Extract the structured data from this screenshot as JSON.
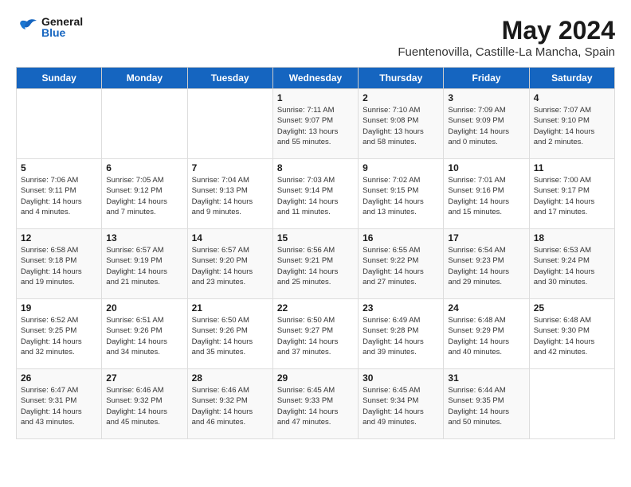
{
  "logo": {
    "general": "General",
    "blue": "Blue"
  },
  "title": "May 2024",
  "subtitle": "Fuentenovilla, Castille-La Mancha, Spain",
  "days_of_week": [
    "Sunday",
    "Monday",
    "Tuesday",
    "Wednesday",
    "Thursday",
    "Friday",
    "Saturday"
  ],
  "weeks": [
    [
      {
        "day": "",
        "info": ""
      },
      {
        "day": "",
        "info": ""
      },
      {
        "day": "",
        "info": ""
      },
      {
        "day": "1",
        "info": "Sunrise: 7:11 AM\nSunset: 9:07 PM\nDaylight: 13 hours\nand 55 minutes."
      },
      {
        "day": "2",
        "info": "Sunrise: 7:10 AM\nSunset: 9:08 PM\nDaylight: 13 hours\nand 58 minutes."
      },
      {
        "day": "3",
        "info": "Sunrise: 7:09 AM\nSunset: 9:09 PM\nDaylight: 14 hours\nand 0 minutes."
      },
      {
        "day": "4",
        "info": "Sunrise: 7:07 AM\nSunset: 9:10 PM\nDaylight: 14 hours\nand 2 minutes."
      }
    ],
    [
      {
        "day": "5",
        "info": "Sunrise: 7:06 AM\nSunset: 9:11 PM\nDaylight: 14 hours\nand 4 minutes."
      },
      {
        "day": "6",
        "info": "Sunrise: 7:05 AM\nSunset: 9:12 PM\nDaylight: 14 hours\nand 7 minutes."
      },
      {
        "day": "7",
        "info": "Sunrise: 7:04 AM\nSunset: 9:13 PM\nDaylight: 14 hours\nand 9 minutes."
      },
      {
        "day": "8",
        "info": "Sunrise: 7:03 AM\nSunset: 9:14 PM\nDaylight: 14 hours\nand 11 minutes."
      },
      {
        "day": "9",
        "info": "Sunrise: 7:02 AM\nSunset: 9:15 PM\nDaylight: 14 hours\nand 13 minutes."
      },
      {
        "day": "10",
        "info": "Sunrise: 7:01 AM\nSunset: 9:16 PM\nDaylight: 14 hours\nand 15 minutes."
      },
      {
        "day": "11",
        "info": "Sunrise: 7:00 AM\nSunset: 9:17 PM\nDaylight: 14 hours\nand 17 minutes."
      }
    ],
    [
      {
        "day": "12",
        "info": "Sunrise: 6:58 AM\nSunset: 9:18 PM\nDaylight: 14 hours\nand 19 minutes."
      },
      {
        "day": "13",
        "info": "Sunrise: 6:57 AM\nSunset: 9:19 PM\nDaylight: 14 hours\nand 21 minutes."
      },
      {
        "day": "14",
        "info": "Sunrise: 6:57 AM\nSunset: 9:20 PM\nDaylight: 14 hours\nand 23 minutes."
      },
      {
        "day": "15",
        "info": "Sunrise: 6:56 AM\nSunset: 9:21 PM\nDaylight: 14 hours\nand 25 minutes."
      },
      {
        "day": "16",
        "info": "Sunrise: 6:55 AM\nSunset: 9:22 PM\nDaylight: 14 hours\nand 27 minutes."
      },
      {
        "day": "17",
        "info": "Sunrise: 6:54 AM\nSunset: 9:23 PM\nDaylight: 14 hours\nand 29 minutes."
      },
      {
        "day": "18",
        "info": "Sunrise: 6:53 AM\nSunset: 9:24 PM\nDaylight: 14 hours\nand 30 minutes."
      }
    ],
    [
      {
        "day": "19",
        "info": "Sunrise: 6:52 AM\nSunset: 9:25 PM\nDaylight: 14 hours\nand 32 minutes."
      },
      {
        "day": "20",
        "info": "Sunrise: 6:51 AM\nSunset: 9:26 PM\nDaylight: 14 hours\nand 34 minutes."
      },
      {
        "day": "21",
        "info": "Sunrise: 6:50 AM\nSunset: 9:26 PM\nDaylight: 14 hours\nand 35 minutes."
      },
      {
        "day": "22",
        "info": "Sunrise: 6:50 AM\nSunset: 9:27 PM\nDaylight: 14 hours\nand 37 minutes."
      },
      {
        "day": "23",
        "info": "Sunrise: 6:49 AM\nSunset: 9:28 PM\nDaylight: 14 hours\nand 39 minutes."
      },
      {
        "day": "24",
        "info": "Sunrise: 6:48 AM\nSunset: 9:29 PM\nDaylight: 14 hours\nand 40 minutes."
      },
      {
        "day": "25",
        "info": "Sunrise: 6:48 AM\nSunset: 9:30 PM\nDaylight: 14 hours\nand 42 minutes."
      }
    ],
    [
      {
        "day": "26",
        "info": "Sunrise: 6:47 AM\nSunset: 9:31 PM\nDaylight: 14 hours\nand 43 minutes."
      },
      {
        "day": "27",
        "info": "Sunrise: 6:46 AM\nSunset: 9:32 PM\nDaylight: 14 hours\nand 45 minutes."
      },
      {
        "day": "28",
        "info": "Sunrise: 6:46 AM\nSunset: 9:32 PM\nDaylight: 14 hours\nand 46 minutes."
      },
      {
        "day": "29",
        "info": "Sunrise: 6:45 AM\nSunset: 9:33 PM\nDaylight: 14 hours\nand 47 minutes."
      },
      {
        "day": "30",
        "info": "Sunrise: 6:45 AM\nSunset: 9:34 PM\nDaylight: 14 hours\nand 49 minutes."
      },
      {
        "day": "31",
        "info": "Sunrise: 6:44 AM\nSunset: 9:35 PM\nDaylight: 14 hours\nand 50 minutes."
      },
      {
        "day": "",
        "info": ""
      }
    ]
  ]
}
